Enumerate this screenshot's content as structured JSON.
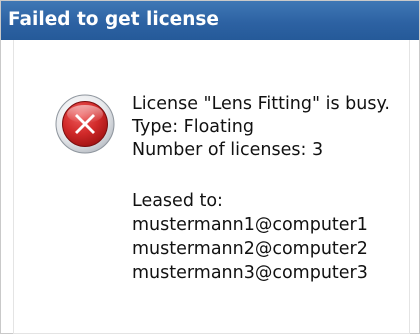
{
  "window": {
    "title": "Failed to get license"
  },
  "icon": {
    "name": "error-icon",
    "colors": {
      "red": "#c4201f",
      "ring": "#dfe3e8",
      "x": "#ffffff"
    }
  },
  "message": {
    "line1": "License \"Lens Fitting\" is busy.",
    "line2": "Type: Floating",
    "line3": "Number of licenses: 3"
  },
  "leases": {
    "heading": "Leased to:",
    "items": [
      "mustermann1@computer1",
      "mustermann2@computer2",
      "mustermann3@computer3"
    ]
  }
}
